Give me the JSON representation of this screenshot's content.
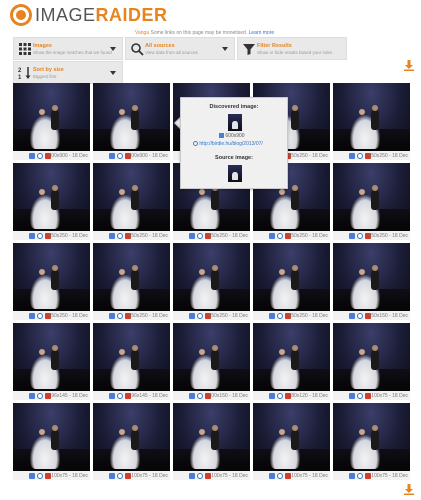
{
  "header": {
    "logo_part1": "IMAGE",
    "logo_part2": "RAIDER",
    "notice_prefix": "Vanga",
    "notice_text": " Some links on this page may be monetised. ",
    "notice_link": "Learn more"
  },
  "filters": [
    {
      "title": "Images",
      "subtitle": "Show the image matches that we found",
      "icon": "grid-icon"
    },
    {
      "title": "All sources",
      "subtitle": "View data from all sources",
      "icon": "search-icon"
    },
    {
      "title": "Filter Results",
      "subtitle": "Show or hide results based your rules",
      "icon": "filter-icon"
    },
    {
      "title": "Sort by size",
      "subtitle": "Biggest first",
      "icon": "sort-icon"
    }
  ],
  "tooltip": {
    "discovered_heading": "Discovered image:",
    "size": "600x900",
    "url": "http://birdie.hu/blog/2013/07/",
    "source_heading": "Source image:"
  },
  "tiles": [
    {
      "size": "600x900",
      "date": "18 Dec"
    },
    {
      "size": "600x900",
      "date": "18 Dec"
    },
    {
      "size": "",
      "date": ""
    },
    {
      "size": "250x250",
      "date": "18 Dec"
    },
    {
      "size": "250x250",
      "date": "18 Dec"
    },
    {
      "size": "250x250",
      "date": "18 Dec"
    },
    {
      "size": "250x250",
      "date": "18 Dec"
    },
    {
      "size": "250x250",
      "date": "18 Dec"
    },
    {
      "size": "250x250",
      "date": "18 Dec"
    },
    {
      "size": "250x250",
      "date": "18 Dec"
    },
    {
      "size": "250x250",
      "date": "18 Dec"
    },
    {
      "size": "250x250",
      "date": "18 Dec"
    },
    {
      "size": "250x250",
      "date": "18 Dec"
    },
    {
      "size": "250x250",
      "date": "18 Dec"
    },
    {
      "size": "150x150",
      "date": "18 Dec"
    },
    {
      "size": "96x145",
      "date": "18 Dec"
    },
    {
      "size": "96x145",
      "date": "18 Dec"
    },
    {
      "size": "100x150",
      "date": "18 Dec"
    },
    {
      "size": "80x120",
      "date": "18 Dec"
    },
    {
      "size": "100x75",
      "date": "18 Dec"
    },
    {
      "size": "100x75",
      "date": "18 Dec"
    },
    {
      "size": "100x75",
      "date": "18 Dec"
    },
    {
      "size": "100x75",
      "date": "18 Dec"
    },
    {
      "size": "100x75",
      "date": "18 Dec"
    },
    {
      "size": "100x75",
      "date": "18 Dec"
    }
  ],
  "colors": {
    "brand": "#e8841f",
    "link": "#2e74c9"
  }
}
